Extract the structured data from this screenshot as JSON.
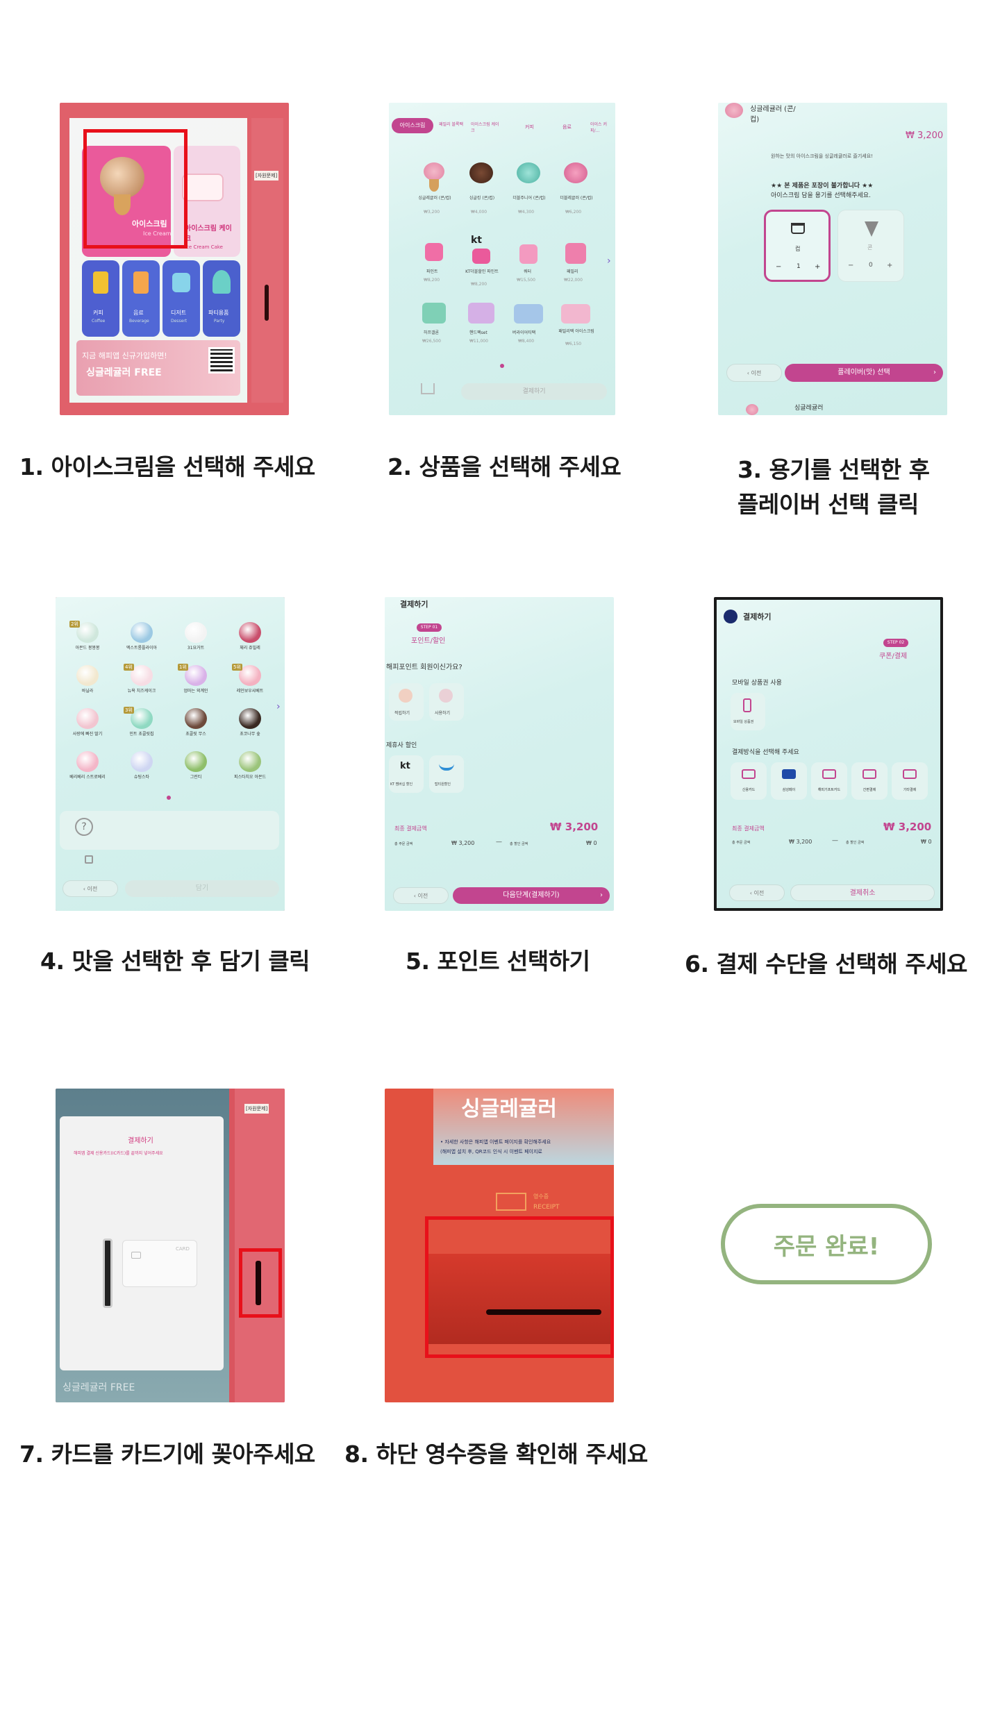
{
  "steps": [
    {
      "caption": "1. 아이스크림을 선택해 주세요",
      "screen": {
        "tile_main_title": "아이스크림",
        "tile_main_sub": "Ice Cream",
        "tile_cake_title": "아이스크림 케이크",
        "tile_cake_sub": "Ice Cream Cake",
        "tiles": [
          {
            "title": "커피",
            "sub": "Coffee"
          },
          {
            "title": "음료",
            "sub": "Beverage"
          },
          {
            "title": "디저트",
            "sub": "Dessert"
          },
          {
            "title": "파티용품",
            "sub": "Party"
          }
        ],
        "banner_line1": "지금 해피앱 신규가입하면!",
        "banner_line2": "싱글레귤러 FREE",
        "side_label": "[자원문제]"
      }
    },
    {
      "caption": "2. 상품을 선택해 주세요",
      "screen": {
        "tabs": [
          "아이스크림",
          "패밀리 블록팩",
          "아이스크림 케이크",
          "커피",
          "음료",
          "아이스 커피/..."
        ],
        "products_row1": [
          {
            "name": "싱글레귤러 (콘/컵)",
            "price": "₩3,200"
          },
          {
            "name": "싱글킹 (콘/컵)",
            "price": "₩4,000"
          },
          {
            "name": "더블주니어 (콘/컵)",
            "price": "₩4,300"
          },
          {
            "name": "더블레귤러 (콘/컵)",
            "price": "₩6,200"
          }
        ],
        "products_row2": [
          {
            "name": "파인트",
            "price": "₩8,200"
          },
          {
            "name": "KT더블할인 파인트",
            "price": "₩8,200"
          },
          {
            "name": "쿼터",
            "price": "₩15,500"
          },
          {
            "name": "패밀리",
            "price": "₩22,000"
          }
        ],
        "products_row3": [
          {
            "name": "하프갤론",
            "price": "₩26,500"
          },
          {
            "name": "핸드팩set",
            "price": "₩11,000"
          },
          {
            "name": "버라이어티팩",
            "price": "₩8,400"
          },
          {
            "name": "패밀리팩 아이스크림",
            "price": "₩6,150"
          }
        ],
        "kt_label": "kt",
        "bottom_button": "결제하기"
      }
    },
    {
      "caption_line1": "3. 용기를 선택한 후",
      "caption_line2": "플레이버 선택 클릭",
      "screen": {
        "product_title": "싱글레귤러 (콘/컵)",
        "price": "₩ 3,200",
        "guide": "원하는 맛의 아이스크림을 싱글레귤러로 즐기세요!",
        "notice_line1": "★★ 본 제품은 포장이 불가합니다 ★★",
        "notice_line2": "아이스크림 담을 용기를 선택해주세요.",
        "cup_label": "컵",
        "cone_label": "콘",
        "cup_qty": "1",
        "cone_qty": "0",
        "back_button": "이전",
        "flavor_button": "플레이버(맛) 선택",
        "footer_title": "싱글레귤러"
      }
    },
    {
      "caption": "4. 맛을 선택한 후 담기 클릭",
      "screen": {
        "flavors": [
          "아몬드 봉봉봉",
          "엑스트롱플라이아",
          "31요거트",
          "체리 쥬빌레",
          "바닐라",
          "뉴욕 치즈케이크",
          "엄마는 외계인",
          "레인보우샤베트",
          "사랑에 빠진 딸기",
          "민트 초콜릿칩",
          "초콜릿 무스",
          "초코나무 숲",
          "베리베리 스트로베리",
          "슈팅스타",
          "그린티",
          "피스타치오 아몬드"
        ],
        "badges": [
          "2위",
          "4위",
          "1위",
          "5위",
          "3위"
        ],
        "back_button": "이전",
        "add_button": "담기"
      }
    },
    {
      "caption": "5. 포인트 선택하기",
      "screen": {
        "header": "결제하기",
        "step_badge": "STEP 01",
        "step_title": "포인트/할인",
        "question": "해피포인트 회원이신가요?",
        "opt1": "적립하기",
        "opt2": "사용하기",
        "partner_title": "제휴사 할인",
        "kt_opt": "KT 멤버십 할인",
        "opt4": "탑티원할인",
        "total_label": "최종 결제금액",
        "total_value": "₩ 3,200",
        "order_label": "총 주문 금액",
        "order_value": "₩ 3,200",
        "discount_label": "총 할인 금액",
        "discount_value": "₩ 0",
        "back_button": "이전",
        "next_button": "다음단계(결제하기)"
      }
    },
    {
      "caption": "6. 결제 수단을 선택해 주세요",
      "screen": {
        "header": "결제하기",
        "step_badge": "STEP 02",
        "step_title": "쿠폰/결제",
        "mobile_title": "모바일 상품권 사용",
        "mobile_opt": "모바일 상품권",
        "pay_title": "결제방식을 선택해 주세요",
        "methods": [
          "신용카드",
          "삼성페이",
          "해피기프트카드",
          "간편결제",
          "기타결제"
        ],
        "total_label": "최종 결제금액",
        "total_value": "₩ 3,200",
        "order_label": "총 주문 금액",
        "order_value": "₩ 3,200",
        "discount_label": "총 할인 금액",
        "discount_value": "₩ 0",
        "back_button": "이전",
        "cancel_button": "결제취소"
      }
    },
    {
      "caption": "7. 카드를 카드기에 꽂아주세요",
      "screen": {
        "title": "결제하기",
        "guide": "해피앱 결제 신용카드(IC카드)를 끝까지 넣어주세요",
        "card_text": "CARD",
        "banner": "싱글레귤러 FREE",
        "side_label": "[자원문제]"
      }
    },
    {
      "caption": "8. 하단 영수증을 확인해 주세요",
      "screen": {
        "sign_text": "싱글레귤러",
        "notice_line1": "• 자세한 사항은 해피앱 이벤트 페이지를 확인해주세요",
        "notice_line2": "(해피앱 설치 후, QR코드 인식 시 이벤트 페이지로",
        "receipt_kr": "영수증",
        "receipt_en": "RECEIPT"
      }
    }
  ],
  "done_button": "주문 완료!",
  "colors": {
    "kiosk_red": "#d9555f",
    "highlight_red": "#e8101a",
    "screen_mint": "#d6f1ee",
    "accent_pink": "#c2458f",
    "done_green": "#94b47f"
  }
}
